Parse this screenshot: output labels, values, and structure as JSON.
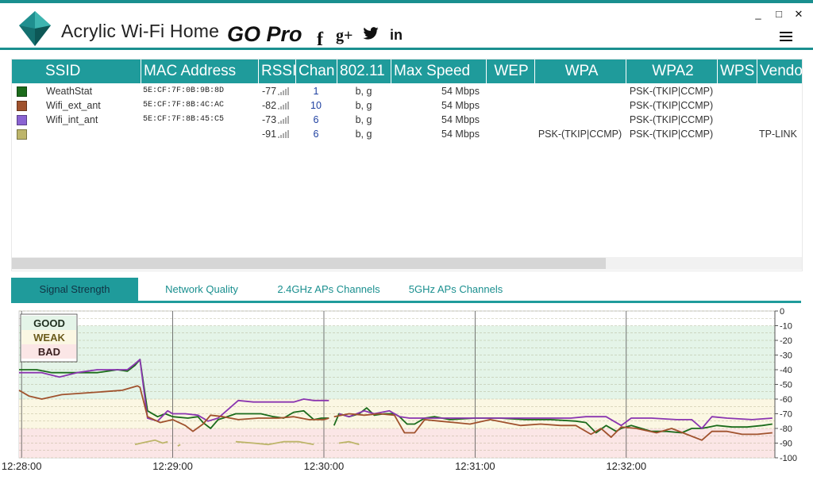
{
  "app": {
    "title": "Acrylic Wi-Fi Home",
    "edition": "GO Pro",
    "social": [
      "f",
      "g+",
      "twitter",
      "in"
    ],
    "window_buttons": [
      "_",
      "□",
      "✕"
    ]
  },
  "table": {
    "columns": [
      "SSID",
      "MAC Address",
      "RSSI",
      "Chan",
      "802.11",
      "Max Speed",
      "WEP",
      "WPA",
      "WPA2",
      "WPS",
      "Vendor"
    ],
    "rows": [
      {
        "color": "#1b6b1b",
        "ssid": "WeathStat",
        "mac": "5E:CF:7F:0B:9B:8D",
        "rssi": "-77",
        "chan": "1",
        "std": "b, g",
        "speed": "54 Mbps",
        "wep": "",
        "wpa": "",
        "wpa2": "PSK-(TKIP|CCMP)",
        "wps": "",
        "vendor": ""
      },
      {
        "color": "#a0522d",
        "ssid": "Wifi_ext_ant",
        "mac": "5E:CF:7F:8B:4C:AC",
        "rssi": "-82",
        "chan": "10",
        "std": "b, g",
        "speed": "54 Mbps",
        "wep": "",
        "wpa": "",
        "wpa2": "PSK-(TKIP|CCMP)",
        "wps": "",
        "vendor": ""
      },
      {
        "color": "#8a63d2",
        "ssid": "Wifi_int_ant",
        "mac": "5E:CF:7F:8B:45:C5",
        "rssi": "-73",
        "chan": "6",
        "std": "b, g",
        "speed": "54 Mbps",
        "wep": "",
        "wpa": "",
        "wpa2": "PSK-(TKIP|CCMP)",
        "wps": "",
        "vendor": ""
      },
      {
        "color": "#bdb56a",
        "ssid": "",
        "mac": "",
        "rssi": "-91",
        "chan": "6",
        "std": "b, g",
        "speed": "54 Mbps",
        "wep": "",
        "wpa": "PSK-(TKIP|CCMP)",
        "wpa2": "PSK-(TKIP|CCMP)",
        "wps": "",
        "vendor": "TP-LINK"
      }
    ]
  },
  "tabs": {
    "items": [
      "Signal Strength",
      "Network Quality",
      "2.4GHz APs Channels",
      "5GHz APs Channels"
    ],
    "active": 0
  },
  "chart_data": {
    "type": "line",
    "legend": [
      "GOOD",
      "WEAK",
      "BAD"
    ],
    "band_colors": {
      "good": "#e4f4e8",
      "weak": "#fbf7e3",
      "bad": "#fbe6e6"
    },
    "y_ticks": [
      "0",
      "-10",
      "-20",
      "-30",
      "-40",
      "-50",
      "-60",
      "-70",
      "-80",
      "-90",
      "-100"
    ],
    "ylim": [
      -100,
      0
    ],
    "x_ticks": [
      "12:28:00",
      "12:29:00",
      "12:30:00",
      "12:31:00",
      "12:32:00"
    ],
    "x_tick_times": [
      0,
      60,
      120,
      180,
      240
    ],
    "xlim": [
      -1,
      299
    ],
    "series": [
      {
        "color": "#1b6b1b",
        "segments": [
          [
            [
              -1,
              -40
            ],
            [
              6,
              -40
            ],
            [
              12,
              -42
            ],
            [
              20,
              -42
            ],
            [
              30,
              -42
            ],
            [
              38,
              -40
            ],
            [
              42,
              -41
            ],
            [
              45,
              -37
            ],
            [
              47,
              -33
            ],
            [
              50,
              -68
            ],
            [
              54,
              -72
            ],
            [
              57,
              -70
            ],
            [
              60,
              -72
            ],
            [
              66,
              -73
            ],
            [
              70,
              -72
            ],
            [
              72,
              -76
            ],
            [
              75,
              -80
            ],
            [
              78,
              -74
            ],
            [
              80,
              -73
            ],
            [
              85,
              -70
            ],
            [
              90,
              -70
            ],
            [
              95,
              -70
            ],
            [
              100,
              -72
            ],
            [
              104,
              -73
            ],
            [
              108,
              -69
            ],
            [
              112,
              -68
            ],
            [
              116,
              -74
            ],
            [
              119,
              -73
            ],
            [
              122,
              -73
            ]
          ],
          [
            [
              124,
              -78
            ],
            [
              126,
              -70
            ],
            [
              130,
              -72
            ],
            [
              134,
              -70
            ],
            [
              137,
              -66
            ],
            [
              140,
              -71
            ],
            [
              144,
              -70
            ],
            [
              148,
              -70
            ],
            [
              150,
              -72
            ],
            [
              153,
              -77
            ],
            [
              156,
              -77
            ],
            [
              160,
              -73
            ],
            [
              164,
              -72
            ],
            [
              170,
              -74
            ],
            [
              180,
              -73
            ],
            [
              190,
              -73
            ],
            [
              200,
              -74
            ],
            [
              210,
              -74
            ],
            [
              220,
              -75
            ],
            [
              224,
              -76
            ],
            [
              228,
              -83
            ],
            [
              232,
              -78
            ],
            [
              236,
              -82
            ],
            [
              238,
              -80
            ],
            [
              242,
              -78
            ],
            [
              246,
              -80
            ],
            [
              250,
              -82
            ],
            [
              256,
              -82
            ],
            [
              262,
              -83
            ],
            [
              266,
              -80
            ],
            [
              270,
              -80
            ],
            [
              276,
              -78
            ],
            [
              282,
              -79
            ],
            [
              288,
              -79
            ],
            [
              294,
              -78
            ],
            [
              298,
              -77
            ]
          ]
        ]
      },
      {
        "color": "#8a35b0",
        "segments": [
          [
            [
              -1,
              -42
            ],
            [
              8,
              -42
            ],
            [
              15,
              -45
            ],
            [
              22,
              -42
            ],
            [
              30,
              -40
            ],
            [
              38,
              -40
            ],
            [
              42,
              -40
            ],
            [
              45,
              -36
            ],
            [
              47,
              -33
            ],
            [
              50,
              -73
            ],
            [
              54,
              -75
            ],
            [
              58,
              -68
            ],
            [
              60,
              -70
            ],
            [
              65,
              -70
            ],
            [
              70,
              -71
            ],
            [
              74,
              -75
            ],
            [
              78,
              -73
            ],
            [
              82,
              -67
            ],
            [
              86,
              -61
            ],
            [
              92,
              -62
            ],
            [
              100,
              -62
            ],
            [
              108,
              -62
            ],
            [
              112,
              -60
            ],
            [
              116,
              -61
            ],
            [
              122,
              -61
            ]
          ],
          [
            [
              126,
              -70
            ],
            [
              130,
              -72
            ],
            [
              136,
              -68
            ],
            [
              140,
              -70
            ],
            [
              146,
              -68
            ],
            [
              150,
              -72
            ],
            [
              154,
              -73
            ],
            [
              160,
              -73
            ],
            [
              166,
              -73
            ],
            [
              176,
              -73
            ],
            [
              186,
              -73
            ],
            [
              196,
              -73
            ],
            [
              206,
              -73
            ],
            [
              218,
              -73
            ],
            [
              224,
              -72
            ],
            [
              232,
              -72
            ],
            [
              238,
              -78
            ],
            [
              242,
              -73
            ],
            [
              250,
              -73
            ],
            [
              260,
              -74
            ],
            [
              266,
              -74
            ],
            [
              270,
              -80
            ],
            [
              274,
              -72
            ],
            [
              280,
              -73
            ],
            [
              290,
              -74
            ],
            [
              298,
              -73
            ]
          ]
        ]
      },
      {
        "color": "#a0522d",
        "segments": [
          [
            [
              -1,
              -54
            ],
            [
              3,
              -58
            ],
            [
              8,
              -60
            ],
            [
              16,
              -57
            ],
            [
              24,
              -56
            ],
            [
              32,
              -55
            ],
            [
              40,
              -54
            ],
            [
              46,
              -51
            ],
            [
              47,
              -52
            ],
            [
              50,
              -72
            ],
            [
              55,
              -76
            ],
            [
              60,
              -74
            ],
            [
              65,
              -78
            ],
            [
              68,
              -82
            ],
            [
              72,
              -77
            ],
            [
              75,
              -71
            ],
            [
              80,
              -72
            ],
            [
              86,
              -74
            ],
            [
              94,
              -73
            ],
            [
              102,
              -73
            ],
            [
              108,
              -72
            ],
            [
              114,
              -74
            ],
            [
              120,
              -74
            ],
            [
              122,
              -73
            ]
          ],
          [
            [
              124,
              -72
            ],
            [
              130,
              -70
            ],
            [
              136,
              -71
            ],
            [
              142,
              -70
            ],
            [
              148,
              -71
            ],
            [
              152,
              -83
            ],
            [
              156,
              -83
            ],
            [
              160,
              -74
            ],
            [
              166,
              -75
            ],
            [
              172,
              -76
            ],
            [
              178,
              -77
            ],
            [
              186,
              -74
            ],
            [
              192,
              -76
            ],
            [
              198,
              -78
            ],
            [
              206,
              -77
            ],
            [
              214,
              -78
            ],
            [
              220,
              -78
            ],
            [
              226,
              -84
            ],
            [
              230,
              -80
            ],
            [
              234,
              -86
            ],
            [
              238,
              -79
            ],
            [
              244,
              -80
            ],
            [
              252,
              -83
            ],
            [
              258,
              -80
            ],
            [
              264,
              -84
            ],
            [
              270,
              -88
            ],
            [
              274,
              -82
            ],
            [
              280,
              -82
            ],
            [
              286,
              -84
            ],
            [
              292,
              -84
            ],
            [
              298,
              -83
            ]
          ]
        ]
      },
      {
        "color": "#bdb56a",
        "segments": [
          [
            [
              45,
              -91
            ],
            [
              50,
              -89
            ],
            [
              53,
              -88
            ],
            [
              56,
              -90
            ],
            [
              58,
              -89
            ]
          ],
          [
            [
              62,
              -92
            ],
            [
              63,
              -91
            ]
          ],
          [
            [
              85,
              -89
            ],
            [
              92,
              -90
            ],
            [
              98,
              -91
            ],
            [
              104,
              -89
            ],
            [
              110,
              -89
            ],
            [
              116,
              -91
            ]
          ],
          [
            [
              126,
              -90
            ],
            [
              130,
              -89
            ],
            [
              134,
              -91
            ]
          ]
        ]
      }
    ]
  }
}
